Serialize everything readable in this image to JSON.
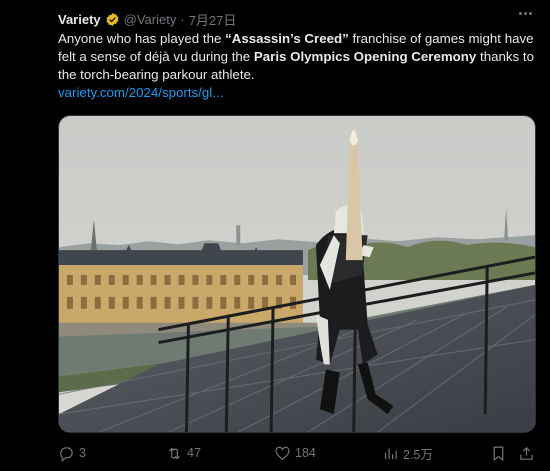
{
  "tweet": {
    "author_name": "Variety",
    "handle": "@Variety",
    "separator": "·",
    "date": "7月27日",
    "text_parts": {
      "p1": "Anyone who has played the ",
      "b1": "“Assassin’s Creed”",
      "p2": " franchise of games might have felt a sense of déjà vu during the ",
      "b2": "Paris Olympics Opening Ceremony",
      "p3": " thanks to the torch-bearing parkour athlete."
    },
    "link": "variety.com/2024/sports/gl..."
  },
  "actions": {
    "replies": "3",
    "reposts": "47",
    "likes": "184",
    "views": "2.5万"
  },
  "icons": {
    "verified": "verified-badge-icon",
    "more": "more-icon",
    "reply": "reply-icon",
    "repost": "repost-icon",
    "like": "heart-icon",
    "views": "views-icon",
    "bookmark": "bookmark-icon",
    "share": "share-icon"
  },
  "colors": {
    "background": "#000000",
    "text": "#e7e9ea",
    "muted": "#71767b",
    "link": "#1d9bf0",
    "verified": "#e8b923"
  }
}
